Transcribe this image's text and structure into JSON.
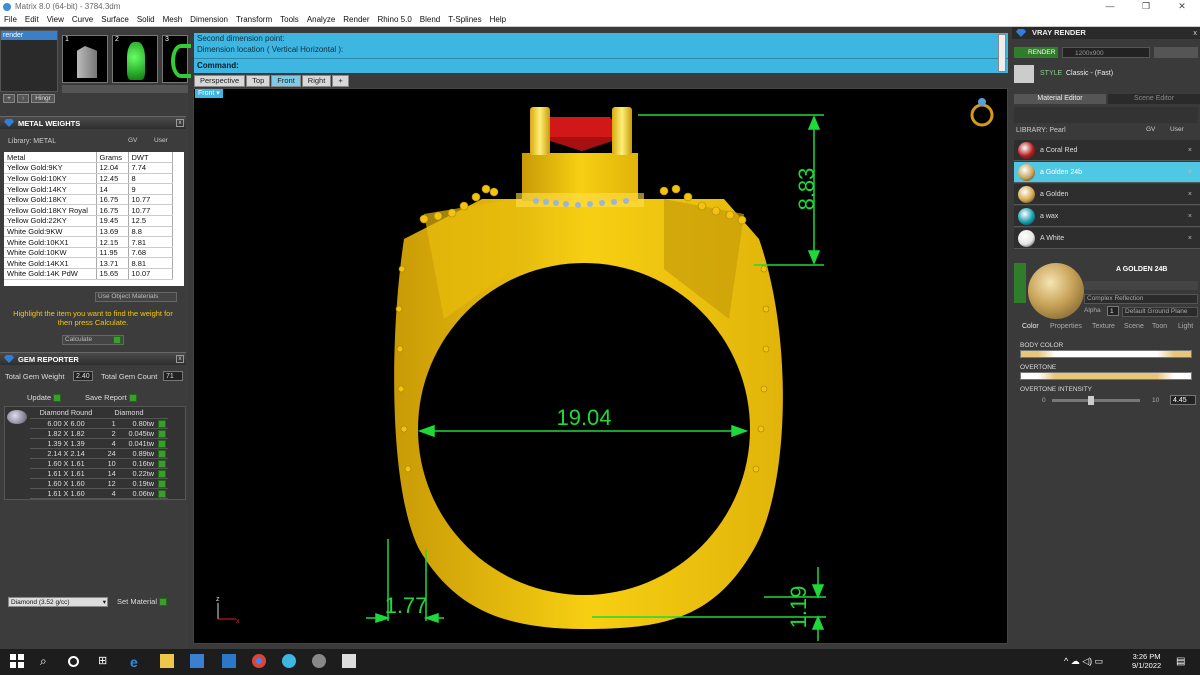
{
  "window": {
    "title": "Matrix 8.0 (64-bit) - 3784.3dm",
    "controls": [
      "—",
      "❐",
      "✕"
    ]
  },
  "menu": [
    "File",
    "Edit",
    "View",
    "Curve",
    "Surface",
    "Solid",
    "Mesh",
    "Dimension",
    "Transform",
    "Tools",
    "Analyze",
    "Render",
    "Rhino 5.0",
    "Blend",
    "T-Splines",
    "Help"
  ],
  "builder": {
    "label": "render",
    "slots": [
      "1",
      "2",
      "3"
    ],
    "buttons": [
      "+",
      "↑",
      "Hingr"
    ]
  },
  "metal_weights": {
    "title": "METAL WEIGHTS",
    "library_label": "Library: METAL",
    "gv": "GV",
    "user": "User",
    "columns": [
      "Metal",
      "Grams",
      "DWT"
    ],
    "rows": [
      [
        "Yellow Gold:9KY",
        "12.04",
        "7.74"
      ],
      [
        "Yellow Gold:10KY",
        "12.45",
        "8"
      ],
      [
        "Yellow Gold:14KY",
        "14",
        "9"
      ],
      [
        "Yellow Gold:18KY",
        "16.75",
        "10.77"
      ],
      [
        "Yellow Gold:18KY Royal",
        "16.75",
        "10.77"
      ],
      [
        "Yellow Gold:22KY",
        "19.45",
        "12.5"
      ],
      [
        "White Gold:9KW",
        "13.69",
        "8.8"
      ],
      [
        "White Gold:10KX1",
        "12.15",
        "7.81"
      ],
      [
        "White Gold:10KW",
        "11.95",
        "7.68"
      ],
      [
        "White Gold:14KX1",
        "13.71",
        "8.81"
      ],
      [
        "White Gold:14K PdW",
        "15.65",
        "10.07"
      ]
    ],
    "use_object": "Use Object Materials",
    "hint": "Highlight the item you want to find the weight for then press Calculate.",
    "calculate": "Calculate"
  },
  "gem_reporter": {
    "title": "GEM REPORTER",
    "total_weight_label": "Total Gem Weight",
    "total_weight": "2.40",
    "total_count_label": "Total Gem Count",
    "total_count": "71",
    "update": "Update",
    "save_report": "Save Report",
    "col1": "Diamond Round",
    "col2": "Diamond",
    "rows": [
      [
        "6.00 X 6.00",
        "1",
        "0.80tw"
      ],
      [
        "1.82 X 1.82",
        "2",
        "0.045tw"
      ],
      [
        "1.39 X 1.39",
        "4",
        "0.041tw"
      ],
      [
        "2.14 X 2.14",
        "24",
        "0.89tw"
      ],
      [
        "1.60 X 1.61",
        "10",
        "0.16tw"
      ],
      [
        "1.61 X 1.61",
        "14",
        "0.22tw"
      ],
      [
        "1.60 X 1.60",
        "12",
        "0.19tw"
      ],
      [
        "1.61 X 1.60",
        "4",
        "0.06tw"
      ]
    ],
    "material_select": "Diamond    (3.52 g/cc)",
    "set_material": "Set Material"
  },
  "command": {
    "line1": "Second dimension point:",
    "line2": "Dimension location ( Vertical  Horizontal ):",
    "prompt": "Command:"
  },
  "viewport": {
    "tabs": [
      "Perspective",
      "Top",
      "Front",
      "Right",
      "+"
    ],
    "active_tab": "Front",
    "label": "Front",
    "dimensions": {
      "top_height": "8.83",
      "inner_diameter": "19.04",
      "shank_width": "1.77",
      "shank_bottom": "1.19"
    },
    "axis_z": "z",
    "axis_x": "x"
  },
  "vray": {
    "title": "VRAY RENDER",
    "render_btn": "RENDER",
    "resolution": "1200x900",
    "style_label": "STYLE",
    "style_value": "Classic - (Fast)",
    "tabs": [
      "Material Editor",
      "Scene Editor"
    ],
    "library_label": "LIBRARY: Pearl",
    "gv": "GV",
    "user": "User",
    "materials": [
      {
        "name": "a Coral Red",
        "color": "#b31a1a"
      },
      {
        "name": "a Golden 24b",
        "color": "#c9a45a"
      },
      {
        "name": "a Golden",
        "color": "#d4a84a"
      },
      {
        "name": "a wax",
        "color": "#139fb2"
      },
      {
        "name": "A White",
        "color": "#e6e6e6"
      }
    ],
    "selected_material": "a Golden 24b",
    "preview_title": "A GOLDEN 24B",
    "preview_type": "Complex Reflection",
    "alpha_label": "Alpha",
    "alpha_value": "1",
    "ground": "Default Ground Plane",
    "prop_tabs": [
      "Color",
      "Properties",
      "Texture",
      "Scene",
      "Toon",
      "Light"
    ],
    "body_color_label": "BODY COLOR",
    "overtone_label": "OVERTONE",
    "overtone_intensity_label": "OVERTONE INTENSITY",
    "intensity_min": "0",
    "intensity_max": "10",
    "intensity_value": "4.45",
    "intensity_fraction": 0.445
  },
  "taskbar": {
    "time": "3:26 PM",
    "date": "9/1/2022"
  },
  "colors": {
    "accent": "#3db6e2",
    "gold": "#f3c60a",
    "dimension": "#1fd83a",
    "gem": "#d01818"
  }
}
